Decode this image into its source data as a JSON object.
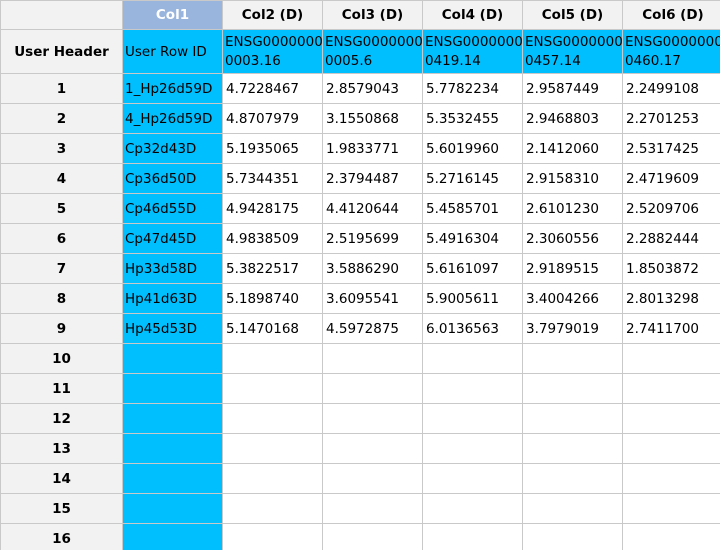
{
  "corner_label": "",
  "columns": [
    "Col1",
    "Col2 (D)",
    "Col3 (D)",
    "Col4 (D)",
    "Col5 (D)",
    "Col6 (D)"
  ],
  "selected_column": "Col1",
  "meta_row": {
    "header": "User Header",
    "id_label": "User Row ID",
    "values": [
      [
        "ENSG0000000",
        "0003.16"
      ],
      [
        "ENSG0000000",
        "0005.6"
      ],
      [
        "ENSG0000000",
        "0419.14"
      ],
      [
        "ENSG0000000",
        "0457.14"
      ],
      [
        "ENSG0000000",
        "0460.17"
      ]
    ]
  },
  "rows": [
    {
      "num": "1",
      "id": "1_Hp26d59D",
      "values": [
        "4.7228467",
        "2.8579043",
        "5.7782234",
        "2.9587449",
        "2.2499108"
      ]
    },
    {
      "num": "2",
      "id": "4_Hp26d59D",
      "values": [
        "4.8707979",
        "3.1550868",
        "5.3532455",
        "2.9468803",
        "2.2701253"
      ]
    },
    {
      "num": "3",
      "id": "Cp32d43D",
      "values": [
        "5.1935065",
        "1.9833771",
        "5.6019960",
        "2.1412060",
        "2.5317425"
      ]
    },
    {
      "num": "4",
      "id": "Cp36d50D",
      "values": [
        "5.7344351",
        "2.3794487",
        "5.2716145",
        "2.9158310",
        "2.4719609"
      ]
    },
    {
      "num": "5",
      "id": "Cp46d55D",
      "values": [
        "4.9428175",
        "4.4120644",
        "5.4585701",
        "2.6101230",
        "2.5209706"
      ]
    },
    {
      "num": "6",
      "id": "Cp47d45D",
      "values": [
        "4.9838509",
        "2.5195699",
        "5.4916304",
        "2.3060556",
        "2.2882444"
      ]
    },
    {
      "num": "7",
      "id": "Hp33d58D",
      "values": [
        "5.3822517",
        "3.5886290",
        "5.6161097",
        "2.9189515",
        "1.8503872"
      ]
    },
    {
      "num": "8",
      "id": "Hp41d63D",
      "values": [
        "5.1898740",
        "3.6095541",
        "5.9005611",
        "3.4004266",
        "2.8013298"
      ]
    },
    {
      "num": "9",
      "id": "Hp45d53D",
      "values": [
        "5.1470168",
        "4.5972875",
        "6.0136563",
        "3.7979019",
        "2.7411700"
      ]
    }
  ],
  "empty_rows": [
    "10",
    "11",
    "12",
    "13",
    "14",
    "15",
    "16"
  ],
  "colors": {
    "id_column": "#00bfff",
    "selected_header": "#99b4dd",
    "header_bg": "#f2f2f2",
    "grid_line": "#c9c9c9"
  }
}
